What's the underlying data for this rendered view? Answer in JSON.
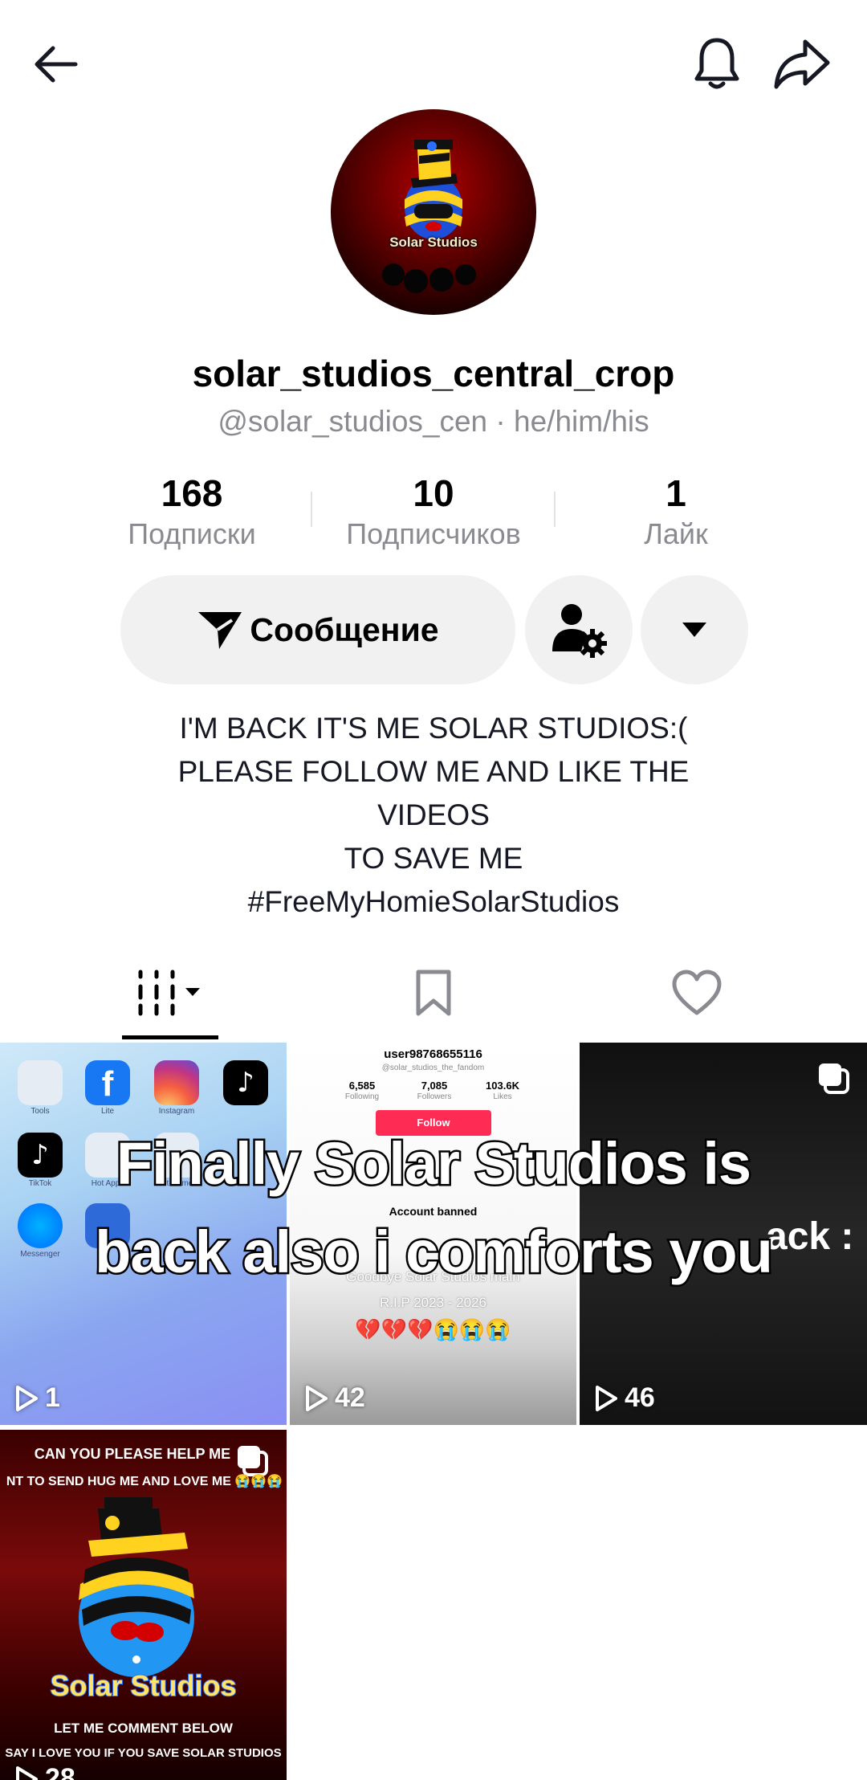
{
  "topbar": {
    "back_icon": "arrow-left-icon",
    "bell_icon": "bell-icon",
    "share_icon": "share-arrow-icon"
  },
  "profile": {
    "avatar_text": "Solar Studios",
    "display_name": "solar_studios_central_crop",
    "username_line": "@solar_studios_cen · he/him/his"
  },
  "stats": [
    {
      "value": "168",
      "label": "Подписки"
    },
    {
      "value": "10",
      "label": "Подписчиков"
    },
    {
      "value": "1",
      "label": "Лайк"
    }
  ],
  "actions": {
    "message_label": "Сообщение"
  },
  "bio": [
    "I'M BACK IT'S ME SOLAR STUDIOS:(",
    "PLEASE FOLLOW ME AND LIKE THE",
    "VIDEOS",
    "TO SAVE ME",
    "#FreeMyHomieSolarStudios"
  ],
  "tabs": [
    {
      "name": "videos",
      "icon": "grid-columns-icon"
    },
    {
      "name": "saved",
      "icon": "bookmark-icon"
    },
    {
      "name": "liked",
      "icon": "heart-icon"
    }
  ],
  "caption_overlay": [
    "Finally Solar Studios is",
    "back also i comforts you"
  ],
  "videos": [
    {
      "views": "1",
      "apps": [
        {
          "label": "Tools"
        },
        {
          "label": "Lite"
        },
        {
          "label": "Instagram"
        },
        {
          "label": ""
        },
        {
          "label": "TikTok"
        },
        {
          "label": "Hot Apps"
        },
        {
          "label": "Hot Games"
        },
        {
          "label": "Messenger"
        }
      ]
    },
    {
      "views": "42",
      "username": "user98768655116",
      "handle": "@solar_studios_the_fandom",
      "stats": [
        {
          "value": "6,585",
          "label": "Following"
        },
        {
          "value": "7,085",
          "label": "Followers"
        },
        {
          "value": "103.6K",
          "label": "Likes"
        }
      ],
      "follow_label": "Follow",
      "banned_label": "Account banned",
      "goodbye": "Goodbye Solar Studios main",
      "rip": "R.I.P 2023 - 2026",
      "emojis": "💔💔💔😭😭😭"
    },
    {
      "views": "46",
      "overlay_text": "ack :"
    },
    {
      "views": "28",
      "top_lines": [
        "CAN YOU PLEASE HELP ME",
        "NT TO SEND HUG ME AND LOVE ME 😭😭😭"
      ],
      "title": "Solar Studios",
      "bottom_lines": [
        "LET ME COMMENT BELOW",
        "SAY I LOVE YOU IF YOU SAVE SOLAR STUDIOS"
      ]
    }
  ],
  "colors": {
    "follow_pink": "#fe2c55",
    "muted_text": "#8a8b91",
    "pill_bg": "#f1f1f2"
  }
}
